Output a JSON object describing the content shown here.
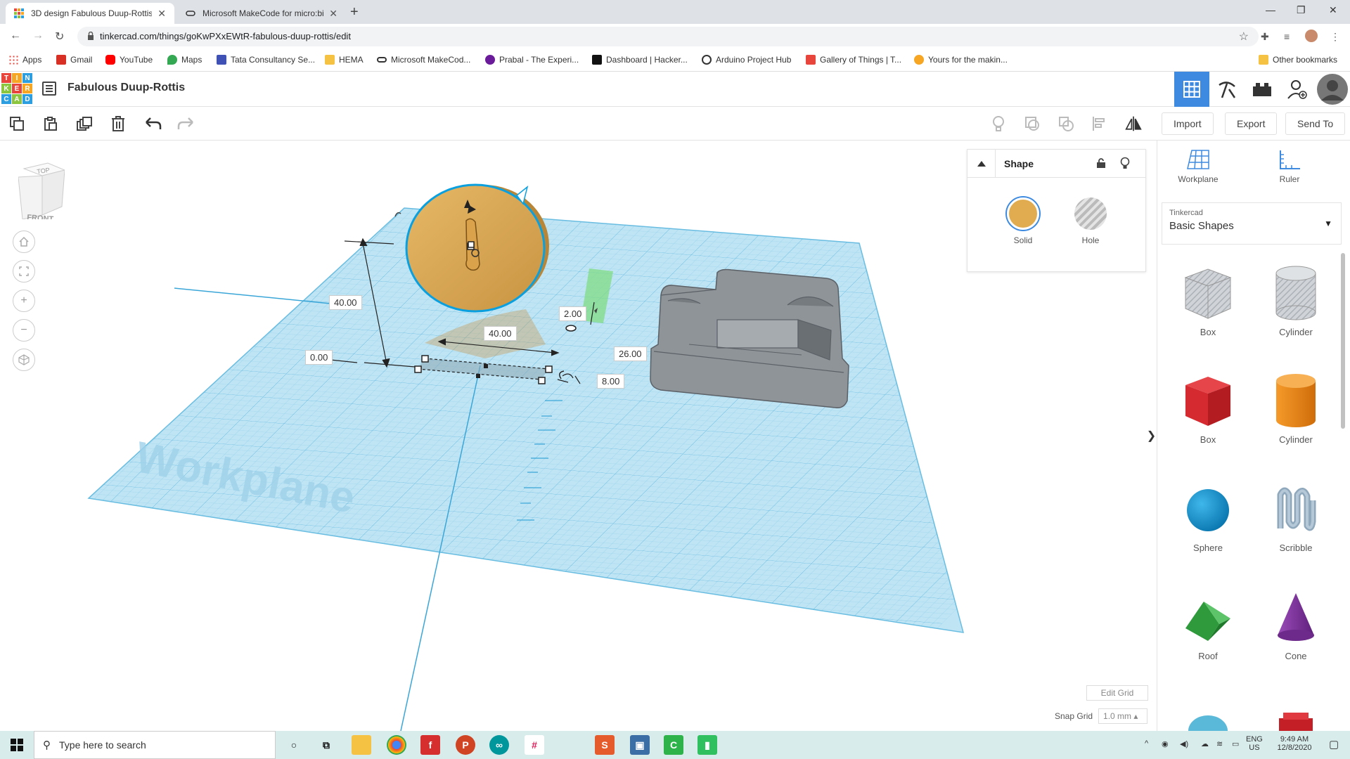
{
  "browser": {
    "tabs": [
      {
        "title": "3D design Fabulous Duup-Rottis",
        "active": true
      },
      {
        "title": "Microsoft MakeCode for micro:bit",
        "active": false
      }
    ],
    "url": "tinkercad.com/things/goKwPXxEWtR-fabulous-duup-rottis/edit",
    "bookmarks": [
      {
        "label": "Apps",
        "color": "#e8453c"
      },
      {
        "label": "Gmail",
        "color": "#d93025"
      },
      {
        "label": "YouTube",
        "color": "#ff0000"
      },
      {
        "label": "Maps",
        "color": "#34a853"
      },
      {
        "label": "Tata Consultancy Se...",
        "color": "#3f51b5"
      },
      {
        "label": "HEMA",
        "color": "#f6c244"
      },
      {
        "label": "Microsoft MakeCod...",
        "color": "#333333"
      },
      {
        "label": "Prabal - The Experi...",
        "color": "#6a1b9a"
      },
      {
        "label": "Dashboard | Hacker...",
        "color": "#111111"
      },
      {
        "label": "Arduino Project Hub",
        "color": "#333333"
      },
      {
        "label": "Gallery of Things | T...",
        "color": "#e8453c"
      },
      {
        "label": "Yours for the makin...",
        "color": "#f6a623"
      }
    ],
    "other_bookmarks": "Other bookmarks"
  },
  "header": {
    "logo_letters": [
      "T",
      "I",
      "N",
      "K",
      "E",
      "R",
      "C",
      "A",
      "D"
    ],
    "logo_colors": [
      "#e8453c",
      "#f6a623",
      "#2d9fe0",
      "#8cc63f",
      "#e8453c",
      "#f6a623",
      "#2d9fe0",
      "#8cc63f",
      "#2d9fe0"
    ],
    "design_title": "Fabulous Duup-Rottis"
  },
  "toolbar": {
    "import_label": "Import",
    "export_label": "Export",
    "sendto_label": "Send To"
  },
  "viewcube": {
    "top": "TOP",
    "front": "FRONT"
  },
  "workspace": {
    "workplane_watermark": "Workplane",
    "dims": {
      "height": "40.00",
      "width": "40.00",
      "elevation": "0.00",
      "thickness": "2.00",
      "offset": "26.00",
      "depth": "8.00"
    }
  },
  "inspector": {
    "title": "Shape",
    "solid_label": "Solid",
    "hole_label": "Hole",
    "solid_color": "#e0ac4f"
  },
  "grid": {
    "edit_grid_label": "Edit Grid",
    "snap_grid_label": "Snap Grid",
    "snap_value": "1.0 mm"
  },
  "right_panel": {
    "workplane_label": "Workplane",
    "ruler_label": "Ruler",
    "library_small": "Tinkercad",
    "library_name": "Basic Shapes",
    "shapes": [
      {
        "label": "Box",
        "kind": "box-hole"
      },
      {
        "label": "Cylinder",
        "kind": "cyl-hole"
      },
      {
        "label": "Box",
        "kind": "box-red"
      },
      {
        "label": "Cylinder",
        "kind": "cyl-orange"
      },
      {
        "label": "Sphere",
        "kind": "sphere"
      },
      {
        "label": "Scribble",
        "kind": "scribble"
      },
      {
        "label": "Roof",
        "kind": "roof"
      },
      {
        "label": "Cone",
        "kind": "cone"
      }
    ]
  },
  "taskbar": {
    "search_placeholder": "Type here to search",
    "lang": "ENG",
    "region": "US",
    "time": "9:49 AM",
    "date": "12/8/2020"
  }
}
